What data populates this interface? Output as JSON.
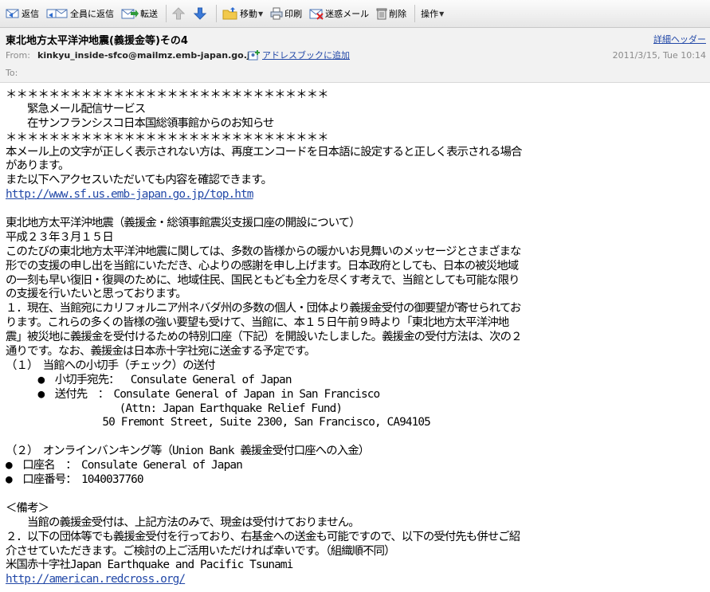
{
  "toolbar": {
    "reply": "返信",
    "reply_all": "全員に返信",
    "forward": "転送",
    "move": "移動",
    "print": "印刷",
    "spam": "迷惑メール",
    "delete": "削除",
    "operation": "操作"
  },
  "header": {
    "subject": "東北地方太平洋沖地震(義援金等)その4",
    "detail_link": "詳細ヘッダー",
    "from_label": "From:",
    "from_address": "kinkyu_inside-sfco@mailmz.emb-japan.go.jp",
    "add_to_addressbook": "アドレスブックに追加",
    "date": "2011/3/15, Tue 10:14",
    "to_label": "To:"
  },
  "body_lines": [
    "＊＊＊＊＊＊＊＊＊＊＊＊＊＊＊＊＊＊＊＊＊＊＊＊＊＊＊＊＊＊",
    "　　緊急メール配信サービス",
    "　　在サンフランシスコ日本国総領事館からのお知らせ",
    "＊＊＊＊＊＊＊＊＊＊＊＊＊＊＊＊＊＊＊＊＊＊＊＊＊＊＊＊＊＊",
    "本メール上の文字が正しく表示されない方は、再度エンコードを日本語に設定すると正しく表示される場合",
    "があります。",
    "また以下へアクセスいただいても内容を確認できます。",
    "http://www.sf.us.emb-japan.go.jp/top.htm",
    "",
    "東北地方太平洋沖地震（義援金・総領事館震災支援口座の開設について）",
    "平成２３年３月１５日",
    "このたびの東北地方太平洋沖地震に関しては、多数の皆様からの暖かいお見舞いのメッセージとさまざまな",
    "形での支援の申し出を当館にいただき、心よりの感謝を申し上げます。日本政府としても、日本の被災地域",
    "の一刻も早い復旧・復興のために、地域住民、国民ともども全力を尽くす考えで、当館としても可能な限り",
    "の支援を行いたいと思っております。",
    "１．現在、当館宛にカリフォルニア州ネバダ州の多数の個人・団体より義援金受付の御要望が寄せられてお",
    "ります。これらの多くの皆様の強い要望も受けて、当館に、本１５日午前９時より「東北地方太平洋沖地",
    "震」被災地に義援金を受付けるための特別口座（下記）を開設いたしました。義援金の受付方法は、次の２",
    "通りです。なお、義援金は日本赤十字社宛に送金する予定です。",
    "（１）　当館への小切手（チェック）の送付",
    "　　　●　小切手宛先：　 Consulate General of Japan",
    "　　　●　送付先　：　Consulate General of Japan in San Francisco",
    "　　　　　　　　　　 (Attn: Japan Earthquake Relief Fund)",
    "　　　　　　　　　50 Fremont Street, Suite 2300, San Francisco, CA94105",
    "",
    "（２）　オンラインバンキング等（Union Bank 義援金受付口座への入金）",
    "●　口座名　：　Consulate General of Japan",
    "●　口座番号：　1040037760",
    "",
    "＜備考＞",
    "　　当館の義援金受付は、上記方法のみで、現金は受付けておりません。",
    "２．以下の団体等でも義援金受付を行っており、右基金への送金も可能ですので、以下の受付先も併せご紹",
    "介させていただきます。ご検討の上ご活用いただければ幸いです。（組織順不同）",
    "米国赤十字社Japan Earthquake and Pacific Tsunami",
    "http://american.redcross.org/"
  ],
  "link_lines": [
    7,
    34
  ],
  "colors": {
    "link": "#2349a8",
    "header_bg": "#f2f2f2",
    "toolbar_bg": "#eeeeee"
  }
}
